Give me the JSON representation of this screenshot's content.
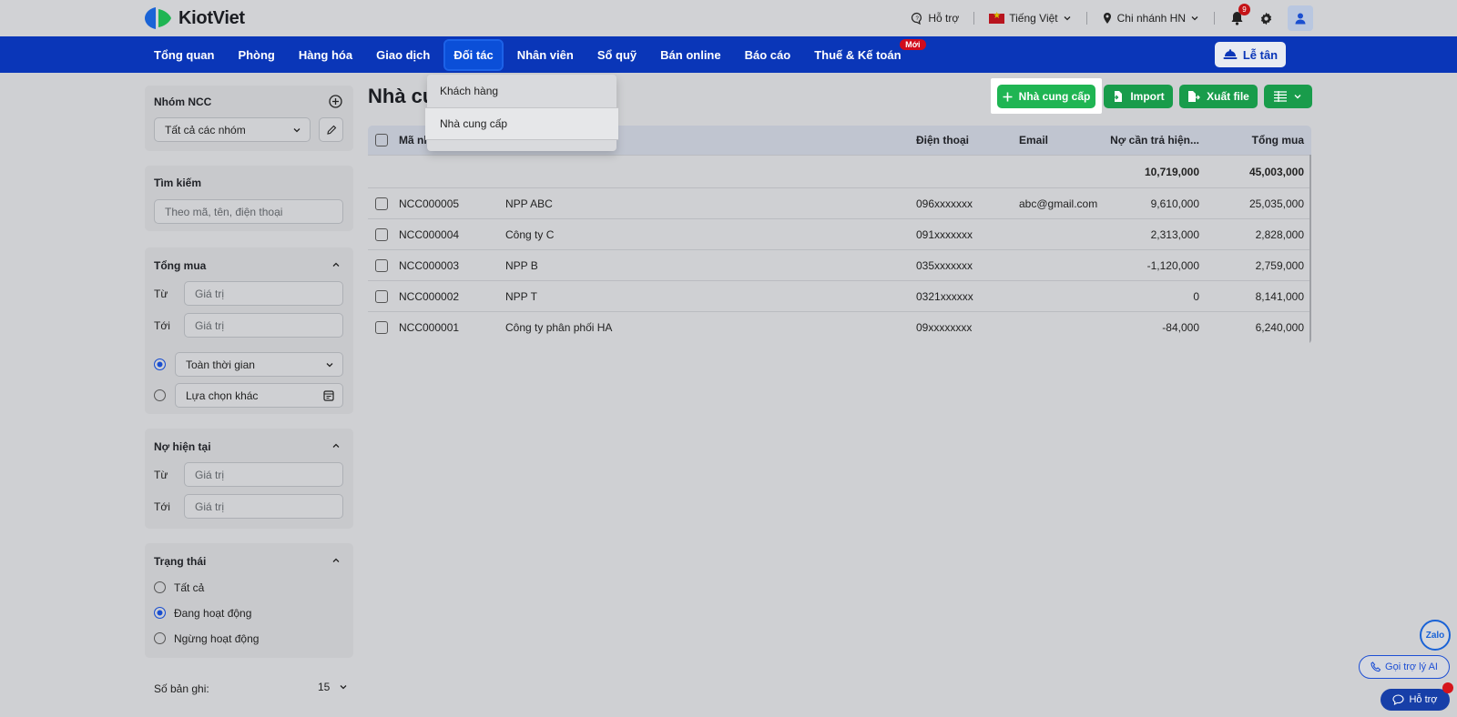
{
  "brand": {
    "name": "KiotViet"
  },
  "topbar": {
    "support": "Hỗ trợ",
    "language": "Tiếng Việt",
    "branch": "Chi nhánh HN",
    "notification_count": "9"
  },
  "nav": {
    "items": [
      "Tổng quan",
      "Phòng",
      "Hàng hóa",
      "Giao dịch",
      "Đối tác",
      "Nhân viên",
      "Sổ quỹ",
      "Bán online",
      "Báo cáo",
      "Thuế & Kế toán"
    ],
    "active_index": 4,
    "new_badge": "Mới",
    "reception": "Lễ tân"
  },
  "dropdown": {
    "items": [
      "Khách hàng",
      "Nhà cung cấp"
    ],
    "selected_index": 1
  },
  "page": {
    "title": "Nhà cu"
  },
  "actions": {
    "add": "Nhà cung cấp",
    "import": "Import",
    "export": "Xuất file"
  },
  "sidebar": {
    "group": {
      "title": "Nhóm NCC",
      "select": "Tất cả các nhóm"
    },
    "search": {
      "title": "Tìm kiếm",
      "placeholder": "Theo mã, tên, điện thoại"
    },
    "total_purchase": {
      "title": "Tổng mua",
      "from_label": "Từ",
      "to_label": "Tới",
      "value_placeholder": "Giá trị",
      "all_time": "Toàn thời gian",
      "custom": "Lựa chọn khác"
    },
    "current_debt": {
      "title": "Nợ hiện tại",
      "from_label": "Từ",
      "to_label": "Tới",
      "value_placeholder": "Giá trị"
    },
    "status": {
      "title": "Trạng thái",
      "options": [
        "Tất cả",
        "Đang hoạt động",
        "Ngừng hoạt động"
      ],
      "selected_index": 1
    },
    "records": {
      "label": "Số bản ghi:",
      "value": "15"
    }
  },
  "table": {
    "headers": {
      "code": "Mã nh",
      "phone": "Điện thoại",
      "email": "Email",
      "debt": "Nợ cần trả hiện...",
      "total": "Tổng mua"
    },
    "summary": {
      "debt": "10,719,000",
      "total": "45,003,000"
    },
    "rows": [
      {
        "code": "NCC000005",
        "name": "NPP ABC",
        "phone": "096xxxxxxx",
        "email": "abc@gmail.com",
        "debt": "9,610,000",
        "total": "25,035,000"
      },
      {
        "code": "NCC000004",
        "name": "Công ty C",
        "phone": "091xxxxxxx",
        "email": "",
        "debt": "2,313,000",
        "total": "2,828,000"
      },
      {
        "code": "NCC000003",
        "name": "NPP B",
        "phone": "035xxxxxxx",
        "email": "",
        "debt": "-1,120,000",
        "total": "2,759,000"
      },
      {
        "code": "NCC000002",
        "name": "NPP T",
        "phone": "0321xxxxxx",
        "email": "",
        "debt": "0",
        "total": "8,141,000"
      },
      {
        "code": "NCC000001",
        "name": "Công ty phân phối HA",
        "phone": "09xxxxxxxx",
        "email": "",
        "debt": "-84,000",
        "total": "6,240,000"
      }
    ]
  },
  "widgets": {
    "zalo": "Zalo",
    "ai": "Gọi trợ lý AI",
    "help": "Hỗ trợ"
  }
}
